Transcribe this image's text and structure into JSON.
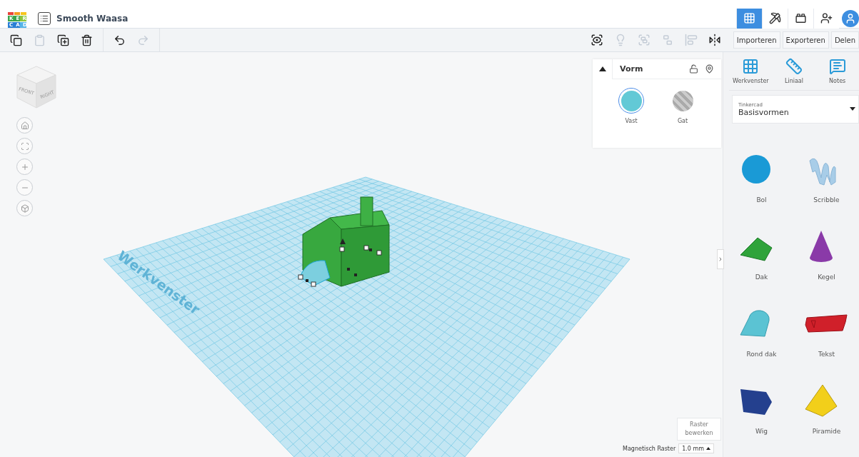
{
  "window": {
    "title": "Smooth Waasa"
  },
  "logo": {
    "rows": [
      "KER",
      "CAD"
    ]
  },
  "nav_tabs": [
    {
      "kind": "grid",
      "selected": true
    },
    {
      "kind": "build",
      "selected": false
    },
    {
      "kind": "bricks",
      "selected": false
    },
    {
      "kind": "add-user",
      "selected": false
    },
    {
      "kind": "avatar",
      "selected": false
    }
  ],
  "toolbar_left": [
    {
      "kind": "copy",
      "disabled": false
    },
    {
      "kind": "paste",
      "disabled": true
    },
    {
      "kind": "duplicate",
      "disabled": false
    },
    {
      "kind": "delete",
      "disabled": false
    },
    {
      "kind": "undo",
      "disabled": false
    },
    {
      "kind": "redo",
      "disabled": true
    }
  ],
  "toolbar_right": [
    {
      "kind": "note",
      "disabled": false
    },
    {
      "kind": "light",
      "disabled": true
    },
    {
      "kind": "group",
      "disabled": true
    },
    {
      "kind": "ungroup",
      "disabled": true
    },
    {
      "kind": "align",
      "disabled": true
    },
    {
      "kind": "mirror",
      "disabled": false
    }
  ],
  "header_buttons": [
    "Importeren",
    "Exporteren",
    "Delen"
  ],
  "view_cube": {
    "front": "FRONT",
    "right": "RIGHT"
  },
  "shape_panel": {
    "title": "Vorm",
    "options": [
      {
        "label": "Vast",
        "kind": "solid",
        "selected": true
      },
      {
        "label": "Gat",
        "kind": "hole",
        "selected": false
      }
    ]
  },
  "workplane": {
    "label": "Werkvenster"
  },
  "grid_controls": {
    "edit_button": "Raster bewerken",
    "snap_label": "Magnetisch Raster",
    "snap_value": "1.0 mm"
  },
  "tools": [
    {
      "kind": "workplane",
      "label": "Werkvenster"
    },
    {
      "kind": "ruler",
      "label": "Liniaal"
    },
    {
      "kind": "notes",
      "label": "Notes"
    }
  ],
  "library": {
    "source": "Tinkercad",
    "value": "Basisvormen"
  },
  "shapes": [
    {
      "kind": "sphere",
      "label": "Bol",
      "color": "#1a9ad6"
    },
    {
      "kind": "scribble",
      "label": "Scribble",
      "color": "#a8cde8"
    },
    {
      "kind": "roof",
      "label": "Dak",
      "color": "#2fa33a"
    },
    {
      "kind": "cone",
      "label": "Kegel",
      "color": "#8a3aa8"
    },
    {
      "kind": "round-roof",
      "label": "Rond dak",
      "color": "#5bc3d3"
    },
    {
      "kind": "text",
      "label": "Tekst",
      "color": "#d0202a"
    },
    {
      "kind": "wedge",
      "label": "Wig",
      "color": "#24408e"
    },
    {
      "kind": "pyramid",
      "label": "Piramide",
      "color": "#f2cf1a"
    }
  ]
}
